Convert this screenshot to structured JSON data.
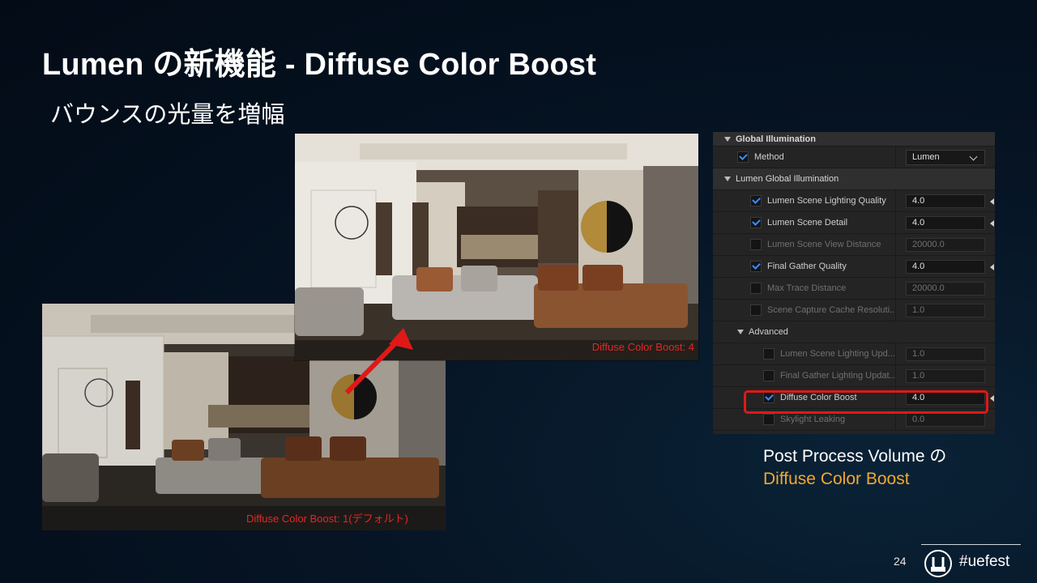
{
  "slide": {
    "title": "Lumen の新機能 - Diffuse Color Boost",
    "subtitle": "バウンスの光量を増幅",
    "page_number": "24",
    "hashtag": "#uefest",
    "caption_line1": "Post Process Volume の",
    "caption_line2": "Diffuse Color Boost",
    "accent_color": "#f0a830"
  },
  "images": {
    "default_caption": "Diffuse Color Boost: 1(デフォルト)",
    "boosted_caption": "Diffuse Color Boost: 4"
  },
  "panel": {
    "section_gi": "Global Illumination",
    "method_label": "Method",
    "method_value": "Lumen",
    "section_lumen_gi": "Lumen Global Illumination",
    "rows": [
      {
        "label": "Lumen Scene Lighting Quality",
        "value": "4.0"
      },
      {
        "label": "Lumen Scene Detail",
        "value": "4.0"
      },
      {
        "label": "Lumen Scene View Distance",
        "value": "20000.0"
      },
      {
        "label": "Final Gather Quality",
        "value": "4.0"
      },
      {
        "label": "Max Trace Distance",
        "value": "20000.0"
      },
      {
        "label": "Scene Capture Cache Resoluti...",
        "value": "1.0"
      }
    ],
    "section_advanced": "Advanced",
    "adv_rows": [
      {
        "label": "Lumen Scene Lighting Upd...",
        "value": "1.0"
      },
      {
        "label": "Final Gather Lighting Updat...",
        "value": "1.0"
      },
      {
        "label": "Diffuse Color Boost",
        "value": "4.0"
      },
      {
        "label": "Skylight Leaking",
        "value": "0.0"
      }
    ]
  }
}
